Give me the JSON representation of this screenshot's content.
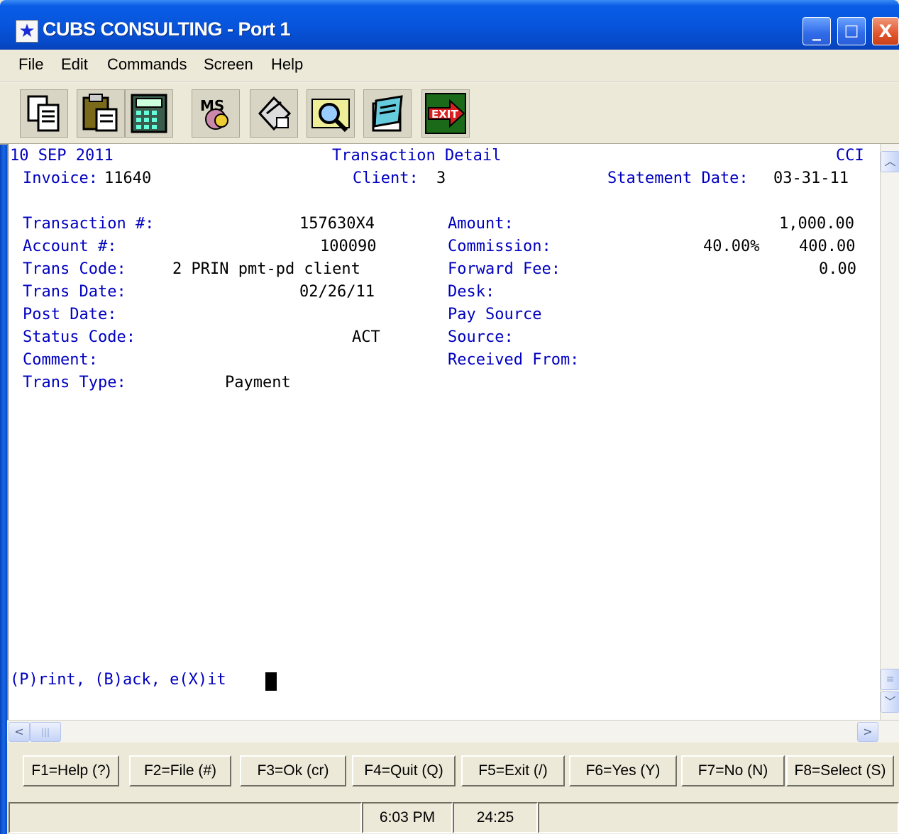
{
  "window": {
    "title": "CUBS CONSULTING - Port 1",
    "minimize": "_",
    "maximize": "□",
    "close": "X"
  },
  "menu": [
    "File",
    "Edit",
    "Commands",
    "Screen",
    "Help"
  ],
  "toolbar": {
    "icons": [
      "copy-icon",
      "paste-icon",
      "calculator-icon",
      "msdos-icon",
      "printer-icon",
      "find-icon",
      "notepad-icon",
      "exit-icon"
    ],
    "exit_label": "EXIT",
    "msdos_label": "MS"
  },
  "screen": {
    "date": "10 SEP 2011",
    "heading": "Transaction Detail",
    "company": "CCI",
    "invoice_label": "Invoice:",
    "invoice_value": "11640",
    "client_label": "Client:",
    "client_value": "3",
    "statement_label": "Statement Date:",
    "statement_value": "03-31-11",
    "left_fields": [
      {
        "label": "Transaction #:",
        "value": "157630X4"
      },
      {
        "label": "Account #:",
        "value": "100090"
      },
      {
        "label": "Trans Code:",
        "value": "2 PRIN pmt-pd client"
      },
      {
        "label": "Trans Date:",
        "value": "02/26/11"
      },
      {
        "label": "Post Date:",
        "value": ""
      },
      {
        "label": "Status Code:",
        "value": "ACT"
      },
      {
        "label": "Comment:",
        "value": ""
      },
      {
        "label": "Trans Type:",
        "value": "Payment"
      }
    ],
    "right_fields": [
      {
        "label": "Amount:",
        "value": "1,000.00",
        "extra": ""
      },
      {
        "label": "Commission:",
        "value": "400.00",
        "extra": "40.00%"
      },
      {
        "label": "Forward Fee:",
        "value": "0.00",
        "extra": ""
      },
      {
        "label": "Desk:",
        "value": "",
        "extra": ""
      },
      {
        "label": "Pay Source",
        "value": "",
        "extra": ""
      },
      {
        "label": "Source:",
        "value": "",
        "extra": ""
      },
      {
        "label": "Received From:",
        "value": "",
        "extra": ""
      }
    ],
    "prompt": "(P)rint, (B)ack, e(X)it"
  },
  "function_keys": [
    "F1=Help (?)",
    "F2=File (#)",
    "F3=Ok (cr)",
    "F4=Quit (Q)",
    "F5=Exit (/)",
    "F6=Yes (Y)",
    "F7=No (N)",
    "F8=Select (S)"
  ],
  "status": {
    "time": "6:03 PM",
    "position": "24:25"
  },
  "colors": {
    "field_label": "#0000c0",
    "field_value": "#000000",
    "title_bar": "#0755dc"
  }
}
